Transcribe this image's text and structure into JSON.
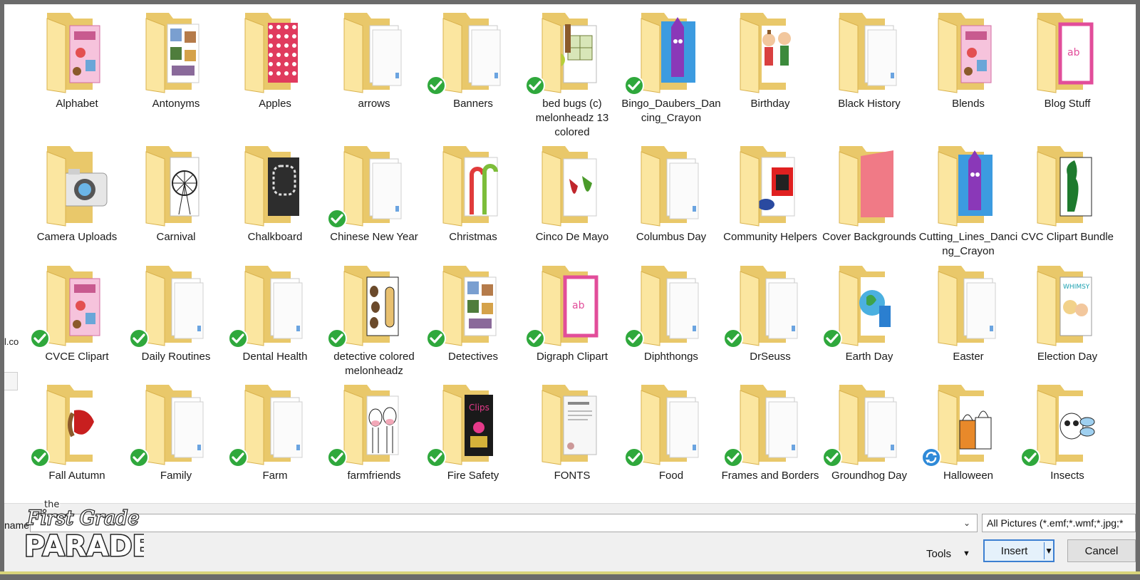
{
  "folders": [
    {
      "name": "Alphabet",
      "status": "none",
      "thumb": "pink"
    },
    {
      "name": "Antonyms",
      "status": "none",
      "thumb": "pictures"
    },
    {
      "name": "Apples",
      "status": "none",
      "thumb": "pink-dots"
    },
    {
      "name": "arrows",
      "status": "none",
      "thumb": "plain"
    },
    {
      "name": "Banners",
      "status": "synced",
      "thumb": "plain"
    },
    {
      "name": "bed bugs (c) melonheadz 13 colored",
      "status": "synced",
      "thumb": "quilt"
    },
    {
      "name": "Bingo_Daubers_Dancing_Crayon",
      "status": "synced",
      "thumb": "crayon"
    },
    {
      "name": "Birthday",
      "status": "none",
      "thumb": "kids"
    },
    {
      "name": "Black History",
      "status": "none",
      "thumb": "plain"
    },
    {
      "name": "Blends",
      "status": "none",
      "thumb": "pink"
    },
    {
      "name": "Blog Stuff",
      "status": "none",
      "thumb": "pink-frame"
    },
    {
      "name": "Camera Uploads",
      "status": "none",
      "thumb": "camera"
    },
    {
      "name": "Carnival",
      "status": "none",
      "thumb": "ferris"
    },
    {
      "name": "Chalkboard",
      "status": "none",
      "thumb": "chalk"
    },
    {
      "name": "Chinese New Year",
      "status": "synced",
      "thumb": "plain"
    },
    {
      "name": "Christmas",
      "status": "none",
      "thumb": "candy"
    },
    {
      "name": "Cinco De Mayo",
      "status": "none",
      "thumb": "peppers"
    },
    {
      "name": "Columbus Day",
      "status": "none",
      "thumb": "plain"
    },
    {
      "name": "Community Helpers",
      "status": "none",
      "thumb": "firehouse"
    },
    {
      "name": "Cover Backgrounds",
      "status": "none",
      "thumb": "coral"
    },
    {
      "name": "Cutting_Lines_Dancing_Crayon",
      "status": "none",
      "thumb": "crayon"
    },
    {
      "name": "CVC Clipart Bundle",
      "status": "none",
      "thumb": "tree"
    },
    {
      "name": "CVCE Clipart",
      "status": "synced",
      "thumb": "pink"
    },
    {
      "name": "Daily Routines",
      "status": "synced",
      "thumb": "plain"
    },
    {
      "name": "Dental Health",
      "status": "synced",
      "thumb": "plain"
    },
    {
      "name": "detective colored melonheadz",
      "status": "synced",
      "thumb": "spots"
    },
    {
      "name": "Detectives",
      "status": "synced",
      "thumb": "pictures"
    },
    {
      "name": "Digraph Clipart",
      "status": "synced",
      "thumb": "pink-frame"
    },
    {
      "name": "Diphthongs",
      "status": "synced",
      "thumb": "plain"
    },
    {
      "name": "DrSeuss",
      "status": "synced",
      "thumb": "plain"
    },
    {
      "name": "Earth Day",
      "status": "synced",
      "thumb": "earth"
    },
    {
      "name": "Easter",
      "status": "none",
      "thumb": "plain"
    },
    {
      "name": "Election Day",
      "status": "none",
      "thumb": "whimsy"
    },
    {
      "name": "Fall Autumn",
      "status": "synced",
      "thumb": "leaf"
    },
    {
      "name": "Family",
      "status": "synced",
      "thumb": "plain"
    },
    {
      "name": "Farm",
      "status": "synced",
      "thumb": "plain"
    },
    {
      "name": "farmfriends",
      "status": "synced",
      "thumb": "cows"
    },
    {
      "name": "Fire Safety",
      "status": "synced",
      "thumb": "clips"
    },
    {
      "name": "FONTS",
      "status": "none",
      "thumb": "doc"
    },
    {
      "name": "Food",
      "status": "synced",
      "thumb": "plain"
    },
    {
      "name": "Frames and Borders",
      "status": "synced",
      "thumb": "plain"
    },
    {
      "name": "Groundhog Day",
      "status": "synced",
      "thumb": "plain"
    },
    {
      "name": "Halloween",
      "status": "syncing",
      "thumb": "bags"
    },
    {
      "name": "Insects",
      "status": "synced",
      "thumb": "bee"
    }
  ],
  "left_clip": {
    "text": "l.co"
  },
  "bottom": {
    "name_label": "name",
    "filename_value": "",
    "filter": "All Pictures (*.emf;*.wmf;*.jpg;*",
    "tools_label": "Tools",
    "insert_label": "Insert",
    "cancel_label": "Cancel"
  },
  "logo": {
    "line1": "the",
    "line2": "First Grade",
    "line3": "PARADE"
  },
  "colors": {
    "folder_back": "#e9c86a",
    "folder_front": "#fbe6a0",
    "check_green": "#2fa83c",
    "sync_blue": "#2f8ad8",
    "accent_blue": "#3c7fd1"
  }
}
